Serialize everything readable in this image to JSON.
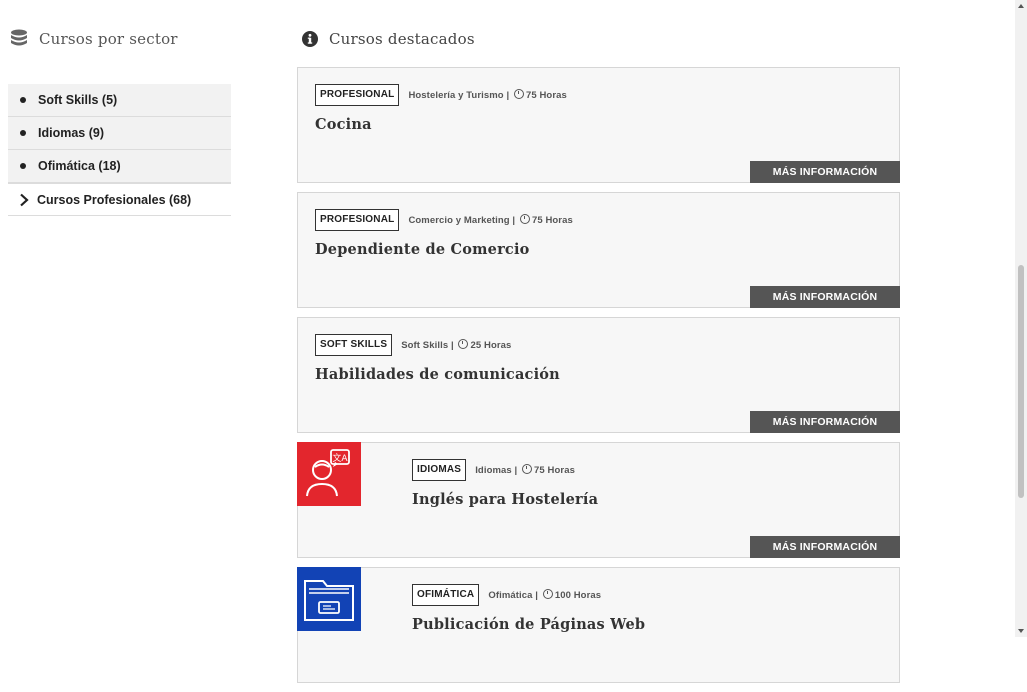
{
  "sidebar": {
    "title": "Cursos por sector",
    "icon": "database-icon",
    "items": [
      {
        "label": "Soft Skills (5)",
        "icon": "bullet-icon"
      },
      {
        "label": "Idiomas (9)",
        "icon": "bullet-icon"
      },
      {
        "label": "Ofimática (18)",
        "icon": "bullet-icon"
      },
      {
        "label": "Cursos Profesionales (68)",
        "icon": "chevron-right-icon"
      }
    ]
  },
  "main": {
    "title": "Cursos destacados",
    "icon": "info-circle-icon",
    "button_label": "MÁS INFORMACIÓN",
    "cards": [
      {
        "tag": "PROFESIONAL",
        "sector": "Hostelería y Turismo |",
        "hours": "75 Horas",
        "title": "Cocina"
      },
      {
        "tag": "PROFESIONAL",
        "sector": "Comercio y Marketing |",
        "hours": "75 Horas",
        "title": "Dependiente de Comercio"
      },
      {
        "tag": "SOFT SKILLS",
        "sector": "Soft Skills |",
        "hours": "25 Horas",
        "title": "Habilidades de comunicación"
      },
      {
        "tag": "IDIOMAS",
        "sector": "Idiomas |",
        "hours": "75 Horas",
        "title": "Inglés para Hostelería",
        "thumb_icon": "translator-person-icon",
        "thumb_color": "#e3262d"
      },
      {
        "tag": "OFIMÁTICA",
        "sector": "Ofimática |",
        "hours": "100 Horas",
        "title": "Publicación de Páginas Web",
        "thumb_icon": "web-folder-icon",
        "thumb_color": "#1243b5"
      }
    ]
  },
  "colors": {
    "button_bg": "#555555",
    "card_bg": "#f7f7f7",
    "sidebar_item_bg": "#f2f2f2"
  }
}
